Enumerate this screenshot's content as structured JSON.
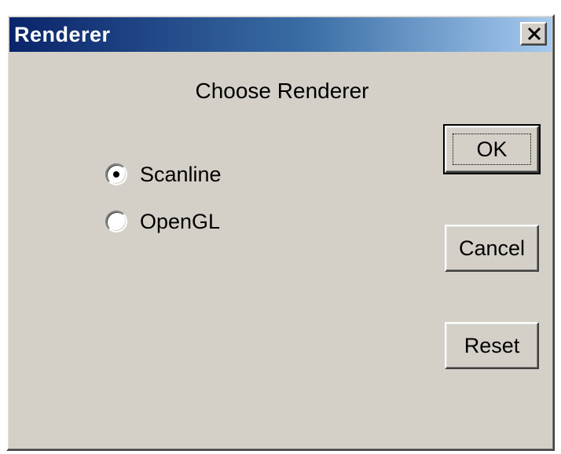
{
  "window": {
    "title": "Renderer",
    "close_glyph": "close-icon"
  },
  "dialog": {
    "heading": "Choose Renderer"
  },
  "renderer_options": [
    {
      "label": "Scanline",
      "selected": true
    },
    {
      "label": "OpenGL",
      "selected": false
    }
  ],
  "buttons": {
    "ok_label": "OK",
    "cancel_label": "Cancel",
    "reset_label": "Reset"
  },
  "colors": {
    "face": "#d4d0c8",
    "title_start": "#0a246a",
    "title_end": "#a6caf0"
  }
}
